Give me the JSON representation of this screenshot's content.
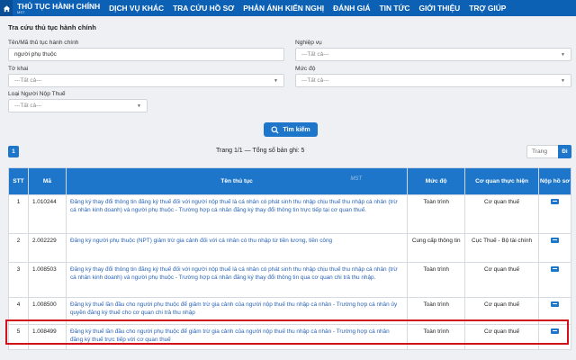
{
  "nav": {
    "items": [
      {
        "label": "THỦ TỤC HÀNH CHÍNH",
        "sub": "MST",
        "active": true
      },
      {
        "label": "DỊCH VỤ KHÁC"
      },
      {
        "label": "TRA CỨU HỒ SƠ"
      },
      {
        "label": "PHẢN ÁNH KIẾN NGHỊ"
      },
      {
        "label": "ĐÁNH GIÁ"
      },
      {
        "label": "TIN TỨC"
      },
      {
        "label": "GIỚI THIỆU"
      },
      {
        "label": "TRỢ GIÚP"
      }
    ]
  },
  "search": {
    "title": "Tra cứu thủ tục hành chính",
    "name_label": "Tên/Mã thủ tục hành chính",
    "name_value": "người phụ thuộc",
    "tokhai_label": "Tờ khai",
    "tokhai_value": "---Tất cả---",
    "nguoinop_label": "Loại Người Nộp Thuế",
    "nguoinop_value": "---Tất cả---",
    "nghiepvu_label": "Nghiệp vụ",
    "nghiepvu_value": "---Tất cả---",
    "mucdo_label": "Mức độ",
    "mucdo_value": "---Tất cả---",
    "button_label": "Tìm kiếm"
  },
  "pagination": {
    "count": "1",
    "info": "Trang 1/1 — Tổng số bản ghi: 5",
    "page_placeholder": "Trang",
    "go_label": "Đi"
  },
  "table": {
    "headers": [
      "STT",
      "Mã",
      "Tên thủ tục",
      "Mức độ",
      "Cơ quan thực hiện",
      "Nộp hồ sơ"
    ],
    "watermark": "MST",
    "rows": [
      {
        "stt": "1",
        "ma": "1.010244",
        "ten": "Đăng ký thay đổi thông tin đăng ký thuế đối với người nộp thuế là cá nhân có phát sinh thu nhập chịu thuế thu nhập cá nhân (trừ cá nhân kinh doanh) và người phụ thuộc - Trường hợp cá nhân đăng ký thay đổi thông tin trực tiếp tại cơ quan thuế.",
        "mucdo": "Toàn trình",
        "coquan": "Cơ quan thuế"
      },
      {
        "stt": "2",
        "ma": "2.002229",
        "ten": "Đăng ký người phụ thuộc (NPT) giảm trừ gia cảnh đối với cá nhân có thu nhập từ tiền lương, tiền công",
        "mucdo": "Cung cấp thông tin",
        "coquan": "Cục Thuế - Bộ tài chính"
      },
      {
        "stt": "3",
        "ma": "1.008503",
        "ten": "Đăng ký thay đổi thông tin đăng ký thuế đối với người nộp thuế là cá nhân có phát sinh thu nhập chịu thuế thu nhập cá nhân (trừ cá nhân kinh doanh) và người phụ thuộc - Trường hợp cá nhân đăng ký thay đổi thông tin qua cơ quan chi trả thu nhập.",
        "mucdo": "Toàn trình",
        "coquan": "Cơ quan thuế"
      },
      {
        "stt": "4",
        "ma": "1.008500",
        "ten": "Đăng ký thuế lần đầu cho người phụ thuộc để giảm trừ gia cảnh của người nộp thuế thu nhập cá nhân - Trường hợp cá nhân ủy quyền đăng ký thuế cho cơ quan chi trả thu nhập",
        "mucdo": "Toàn trình",
        "coquan": "Cơ quan thuế"
      },
      {
        "stt": "5",
        "ma": "1.008499",
        "ten": "Đăng ký thuế lần đầu cho người phụ thuộc để giảm trừ gia cảnh của người nộp thuế thu nhập cá nhân - Trường hợp cá nhân đăng ký thuế trực tiếp với cơ quan thuế",
        "mucdo": "Toàn trình",
        "coquan": "Cơ quan thuế"
      }
    ]
  },
  "icons": {
    "home": "home-icon",
    "search": "search-icon",
    "submit": "submit-doc-icon"
  },
  "colors": {
    "primary": "#1d76c9",
    "nav": "#0c61b5",
    "highlight": "#d1121b",
    "link": "#2a64b5"
  }
}
